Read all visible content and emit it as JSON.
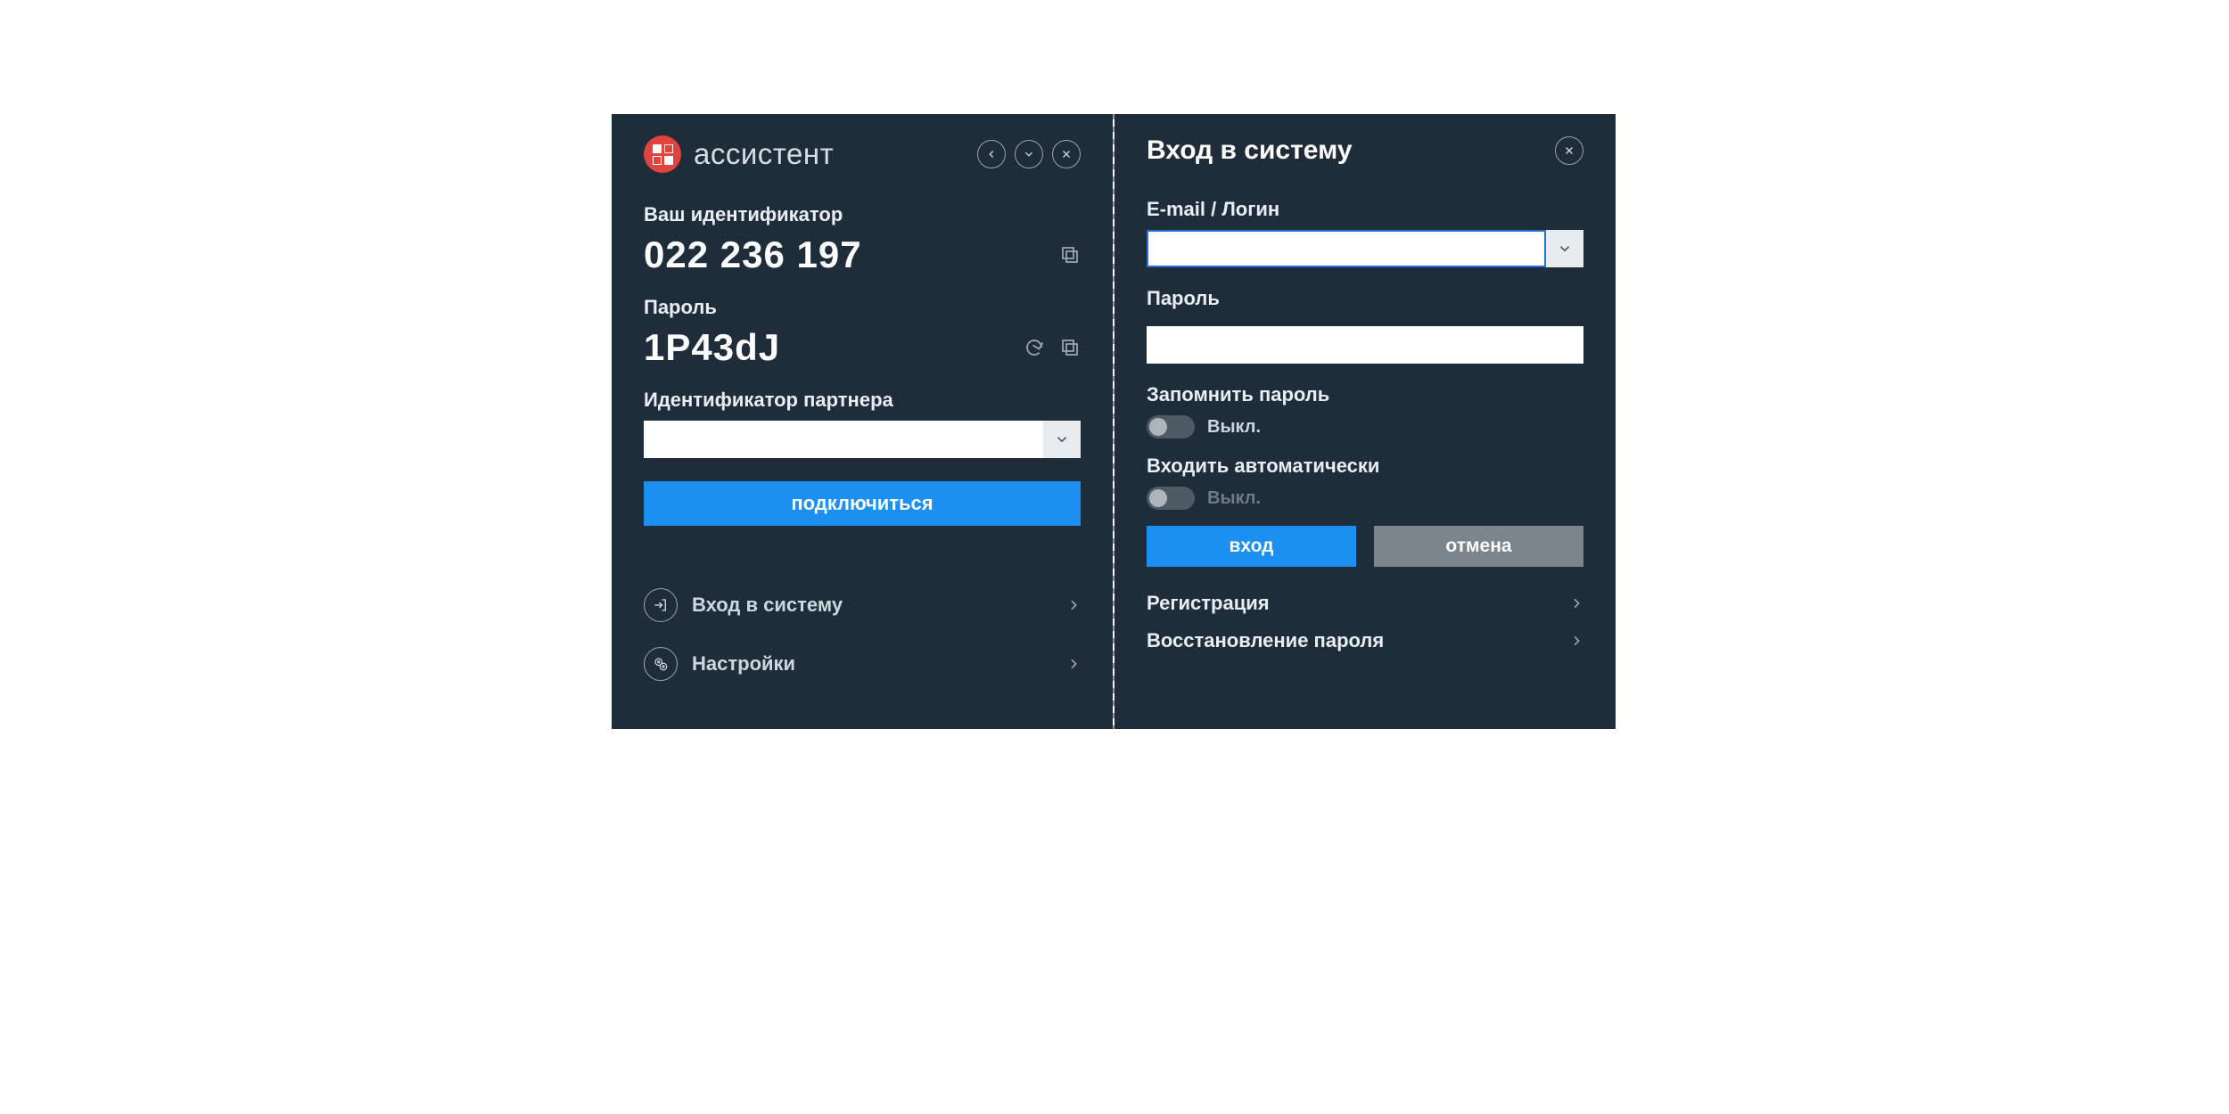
{
  "app": {
    "title": "ассистент"
  },
  "left": {
    "id_label": "Ваш идентификатор",
    "id_value": "022 236 197",
    "pwd_label": "Пароль",
    "pwd_value": "1P43dJ",
    "partner_label": "Идентификатор партнера",
    "partner_value": "",
    "connect_btn": "подключиться",
    "nav_login": "Вход в систему",
    "nav_settings": "Настройки"
  },
  "right": {
    "title": "Вход в систему",
    "email_label": "E-mail / Логин",
    "email_value": "",
    "pwd_label": "Пароль",
    "pwd_value": "",
    "remember_label": "Запомнить пароль",
    "auto_label": "Входить автоматически",
    "toggle_off_text": "Выкл.",
    "btn_login": "вход",
    "btn_cancel": "отмена",
    "link_register": "Регистрация",
    "link_recover": "Восстановление пароля"
  },
  "icons": {
    "back": "back-icon",
    "dropdown": "chevron-down-icon",
    "close": "close-icon",
    "copy": "copy-icon",
    "refresh": "refresh-icon",
    "login": "login-icon",
    "settings": "gear-icon",
    "chevron": "chevron-right-icon"
  }
}
